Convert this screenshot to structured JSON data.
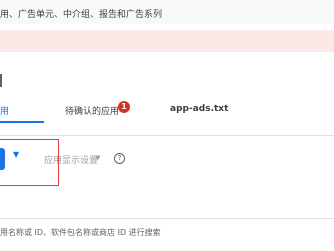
{
  "topbar": {
    "text": "用、广告单元、中介组、报告和广告系列"
  },
  "tabs": [
    {
      "label": "用"
    },
    {
      "label": "待确认的应用",
      "badge": "1"
    },
    {
      "label": "app-ads.txt"
    }
  ],
  "toolbar": {
    "caret": "▼",
    "display_settings_label": "应用显示设置",
    "display_settings_caret": "▼",
    "help_icon_glyph": "?"
  },
  "search": {
    "placeholder": "用名称或 ID、软件包名称或商店 ID 进行搜索"
  },
  "colors": {
    "accent": "#1a73e8",
    "badge": "#d93025",
    "banner": "#fce8e6",
    "highlight": "#e53935"
  }
}
